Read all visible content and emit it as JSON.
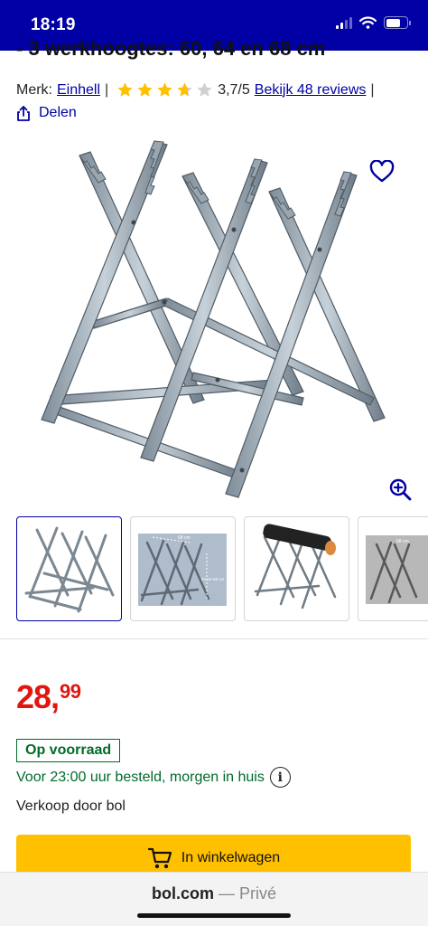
{
  "status_bar": {
    "time": "18:19",
    "icons": [
      "signal-icon",
      "wifi-icon",
      "battery-icon"
    ]
  },
  "product": {
    "title_fragment": "- 3 werkhoogtes: 60, 64 en 68 cm",
    "brand_label": "Merk:",
    "brand": "Einhell",
    "rating": 3.7,
    "rating_max": 5,
    "rating_text": "3,7/5",
    "reviews_link": "Bekijk 48 reviews",
    "share_label": "Delen",
    "thumbnails": [
      {
        "name": "thumb-sawhorse-front"
      },
      {
        "name": "thumb-sawhorse-dimensions",
        "labels": [
          "68 cm",
          "60-64-68 cm"
        ]
      },
      {
        "name": "thumb-sawhorse-with-log"
      },
      {
        "name": "thumb-sawhorse-grey",
        "labels": [
          "68 cm"
        ]
      }
    ]
  },
  "buy_box": {
    "price_main": "28,",
    "price_fraction": "99",
    "stock": "Op voorraad",
    "delivery": "Voor 23:00 uur besteld, morgen in huis",
    "seller": "Verkoop door bol",
    "cart_button": "In winkelwagen"
  },
  "browser": {
    "domain": "bol.com",
    "mode": "— Privé"
  },
  "colors": {
    "brand_blue": "#0000a4",
    "price_red": "#e1160f",
    "stock_green": "#006b2a",
    "cta_yellow": "#ffc000",
    "star_yellow": "#ffc000"
  }
}
